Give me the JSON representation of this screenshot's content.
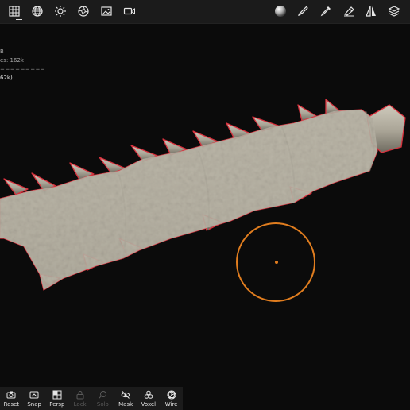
{
  "toolbar_left": [
    {
      "icon": "grid-icon"
    },
    {
      "icon": "sphere-grid-icon"
    },
    {
      "icon": "sun-icon"
    },
    {
      "icon": "camera-aperture-icon"
    },
    {
      "icon": "image-icon"
    },
    {
      "icon": "video-camera-icon"
    }
  ],
  "toolbar_right": [
    {
      "icon": "material-sphere-icon"
    },
    {
      "icon": "brush-icon"
    },
    {
      "icon": "pipette-icon"
    },
    {
      "icon": "smudge-tool-icon"
    },
    {
      "icon": "symmetry-icon"
    },
    {
      "icon": "layers-icon"
    }
  ],
  "info": {
    "line1": "B",
    "line2": "es: 162k",
    "line3": "=========",
    "line4": "62k)"
  },
  "bottom": [
    {
      "label": "Reset",
      "icon": "reset-camera-icon",
      "enabled": true
    },
    {
      "label": "Snap",
      "icon": "snap-icon",
      "enabled": true
    },
    {
      "label": "Persp",
      "icon": "perspective-icon",
      "enabled": true
    },
    {
      "label": "Lock",
      "icon": "lock-icon",
      "enabled": false
    },
    {
      "label": "Solo",
      "icon": "magnifier-icon",
      "enabled": false
    },
    {
      "label": "Mask",
      "icon": "eye-slash-icon",
      "enabled": true
    },
    {
      "label": "Voxel",
      "icon": "voxel-icon",
      "enabled": true
    },
    {
      "label": "Wire",
      "icon": "wireframe-icon",
      "enabled": true
    }
  ],
  "colors": {
    "background": "#0b0b0b",
    "toolbar": "#1b1b1b",
    "mesh": "#b9b4a6",
    "outline": "#d8323e",
    "brush": "#e07d1f"
  }
}
